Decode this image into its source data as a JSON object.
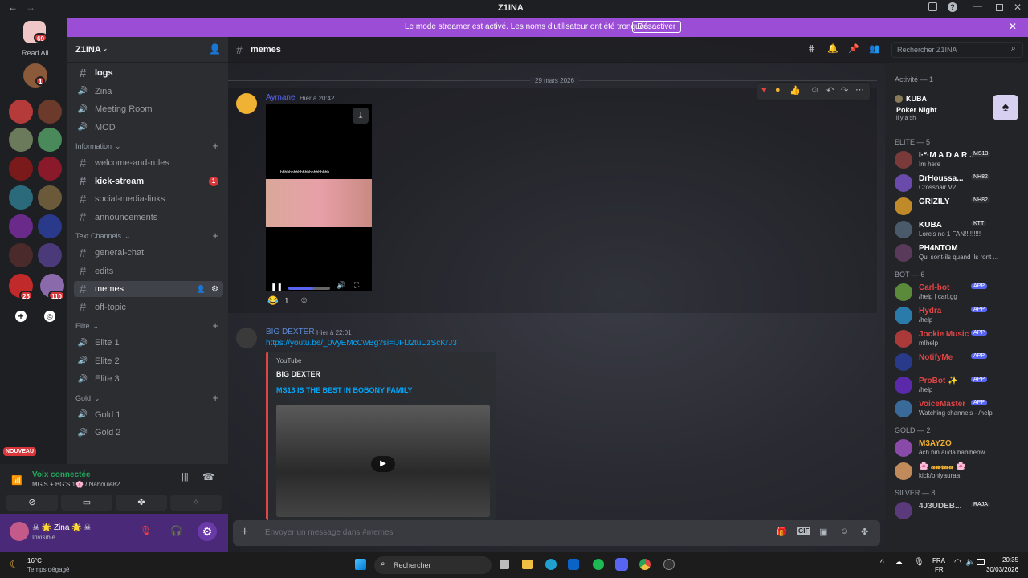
{
  "window": {
    "title": "Z1INA"
  },
  "banner": {
    "text": "Le mode streamer est activé. Les noms d'utilisateur ont été tronqués.",
    "button": "Désactiver"
  },
  "servers": {
    "read_all": "Read All",
    "badges": [
      "69",
      "1",
      "1",
      "1",
      "1",
      "25",
      "110"
    ],
    "new_label": "NOUVEAU"
  },
  "server_name": "Z1INA",
  "channels": [
    {
      "name": "logs",
      "type": "text",
      "bold": true
    },
    {
      "name": "Zina",
      "type": "voice"
    },
    {
      "name": "Meeting Room",
      "type": "voice"
    },
    {
      "name": "MOD",
      "type": "voice"
    },
    {
      "cat": "Information"
    },
    {
      "name": "welcome-and-rules",
      "type": "text"
    },
    {
      "name": "kick-stream",
      "type": "text",
      "bold": true,
      "badge": "1"
    },
    {
      "name": "social-media-links",
      "type": "text"
    },
    {
      "name": "announcements",
      "type": "text"
    },
    {
      "cat": "Text Channels"
    },
    {
      "name": "general-chat",
      "type": "text"
    },
    {
      "name": "edits",
      "type": "text"
    },
    {
      "name": "memes",
      "type": "text",
      "active": true
    },
    {
      "name": "off-topic",
      "type": "text"
    },
    {
      "cat": "Elite"
    },
    {
      "name": "Elite 1",
      "type": "voice"
    },
    {
      "name": "Elite 2",
      "type": "voice"
    },
    {
      "name": "Elite 3",
      "type": "voice"
    },
    {
      "cat": "Gold"
    },
    {
      "name": "Gold 1",
      "type": "voice"
    },
    {
      "name": "Gold 2",
      "type": "voice"
    }
  ],
  "voice": {
    "status": "Voix connectée",
    "channel": "MG'S + BG'S 1🌸 / Nahoule82"
  },
  "user": {
    "name": "☠ 🌟 Zina 🌟 ☠",
    "status": "Invisible"
  },
  "header": {
    "channel": "memes",
    "search_placeholder": "Rechercher Z1INA"
  },
  "date_divider": "29 mars 2026",
  "messages": [
    {
      "author": "Aymane",
      "time": "Hier à 20:42",
      "reaction_count": "1",
      "video_caption": "hhhhhhhhhhhhhhhhhhhhhh"
    },
    {
      "author": "BIG DEXTER",
      "time": "Hier à 22:01",
      "link": "https://youtu.be/_0VyEMcCwBg?si=iJFlJ2tuUzScKrJ3",
      "embed_provider": "YouTube",
      "embed_author": "BIG DEXTER",
      "embed_title": "MS13 IS THE BEST IN BOBONY FAMILY"
    }
  ],
  "composer": {
    "placeholder": "Envoyer un message dans #memes"
  },
  "members": {
    "activity_header": "Activité — 1",
    "activity": {
      "name": "KUBA",
      "game": "Poker Night",
      "time": "il y a 5h"
    },
    "groups": [
      {
        "title": "ELITE — 5",
        "items": [
          {
            "name": "I·ᐡ·M A D A R ...",
            "tag": "MS13",
            "status": "Im here",
            "color": "#ffffff"
          },
          {
            "name": "DrHoussa...",
            "tag": "NH82",
            "status": "Crosshair V2",
            "color": "#ffffff"
          },
          {
            "name": "GRIZILY",
            "tag": "NH82",
            "status": "",
            "color": "#ffffff"
          },
          {
            "name": "KUBA",
            "tag": "KTT",
            "status": "Lore's no 1 FAN!!!!!!!!!",
            "color": "#ffffff"
          },
          {
            "name": "PH4NTOM",
            "tag": "",
            "status": "Qui sont-ils quand ils ront ...",
            "color": "#ffffff"
          }
        ]
      },
      {
        "title": "BOT — 6",
        "items": [
          {
            "name": "Carl-bot",
            "tag": "APP",
            "status": "/help | carl.gg",
            "color": "#e04545"
          },
          {
            "name": "Hydra",
            "tag": "APP",
            "status": "/help",
            "color": "#e04545"
          },
          {
            "name": "Jockie Music",
            "tag": "APP",
            "status": "m!help",
            "color": "#e04545"
          },
          {
            "name": "NotifyMe",
            "tag": "APP",
            "status": "",
            "color": "#e04545"
          },
          {
            "name": "ProBot ✨",
            "tag": "APP",
            "status": "/help",
            "color": "#e04545"
          },
          {
            "name": "VoiceMaster",
            "tag": "APP",
            "status": "Watching channels - /help",
            "color": "#e04545"
          }
        ]
      },
      {
        "title": "GOLD — 2",
        "items": [
          {
            "name": "M3AYZO",
            "tag": "",
            "status": "ach bin auda habibeow",
            "color": "#f0b232"
          },
          {
            "name": "🌸 𝓪𝓾𝓻𝓪𝓪 🌸",
            "tag": "",
            "status": "kick/onlyauraa",
            "color": "#f0b232"
          }
        ]
      },
      {
        "title": "SILVER — 8",
        "items": [
          {
            "name": "4J3UDEB...",
            "tag": "RAJA",
            "status": "",
            "color": "#c0c0c0"
          }
        ]
      }
    ]
  },
  "taskbar": {
    "weather_temp": "16°C",
    "weather_text": "Temps dégagé",
    "search": "Rechercher",
    "lang1": "FRA",
    "lang2": "FR",
    "time": "20:35",
    "date": "30/03/2026"
  }
}
